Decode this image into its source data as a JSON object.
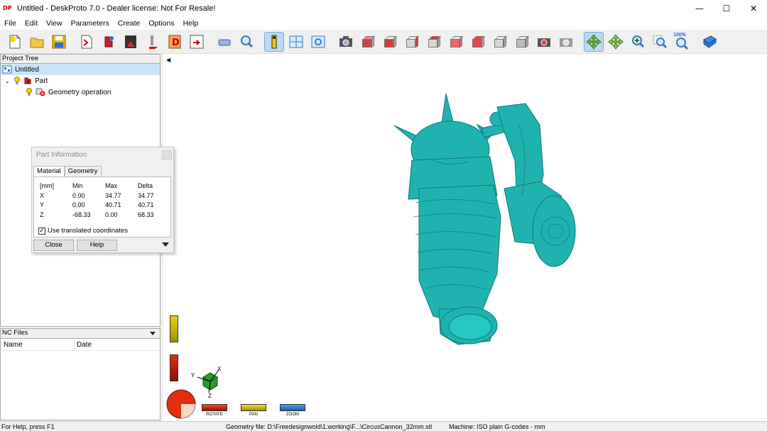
{
  "window": {
    "title": "Untitled - DeskProto 7.0 - Dealer license: Not For Resale!",
    "logo_text": "DP",
    "minimize": "—",
    "maximize": "☐",
    "close": "✕"
  },
  "menu": [
    "File",
    "Edit",
    "View",
    "Parameters",
    "Create",
    "Options",
    "Help"
  ],
  "toolbar": {
    "zoom_label": "100%"
  },
  "project_tree": {
    "header": "Project Tree",
    "root": "Untitled",
    "part": "Part",
    "operation": "Geometry operation"
  },
  "nc_files": {
    "header": "NC Files",
    "col_name": "Name",
    "col_date": "Date"
  },
  "part_info": {
    "title": "Part Information",
    "tabs": [
      "Material",
      "Geometry"
    ],
    "headers": [
      "[mm]",
      "Min",
      "Max",
      "Delta"
    ],
    "rows": [
      [
        "X",
        "0.00",
        "34.77",
        "34.77"
      ],
      [
        "Y",
        "0.00",
        "40.71",
        "40.71"
      ],
      [
        "Z",
        "-68.33",
        "0.00",
        "68.33"
      ]
    ],
    "checkbox_label": "Use translated coordinates",
    "close_label": "Close",
    "help_label": "Help"
  },
  "viewport": {
    "axis_x": "X",
    "axis_y": "Y",
    "axis_z": "Z",
    "rotate_label": "ROTATE",
    "pan_label": "PAN",
    "zoom_label": "ZOOM"
  },
  "status": {
    "help": "For Help, press F1",
    "geometry_file": "Geometry file: D:\\Freedesignwold\\1.working\\F...\\CircusCannon_32mm.stl",
    "machine": "Machine: ISO plain G-codes - mm"
  },
  "colors": {
    "model": "#1fb3b0",
    "rotate": "#e03010",
    "pan": "#e8d010",
    "zoom": "#2a7fd8"
  }
}
